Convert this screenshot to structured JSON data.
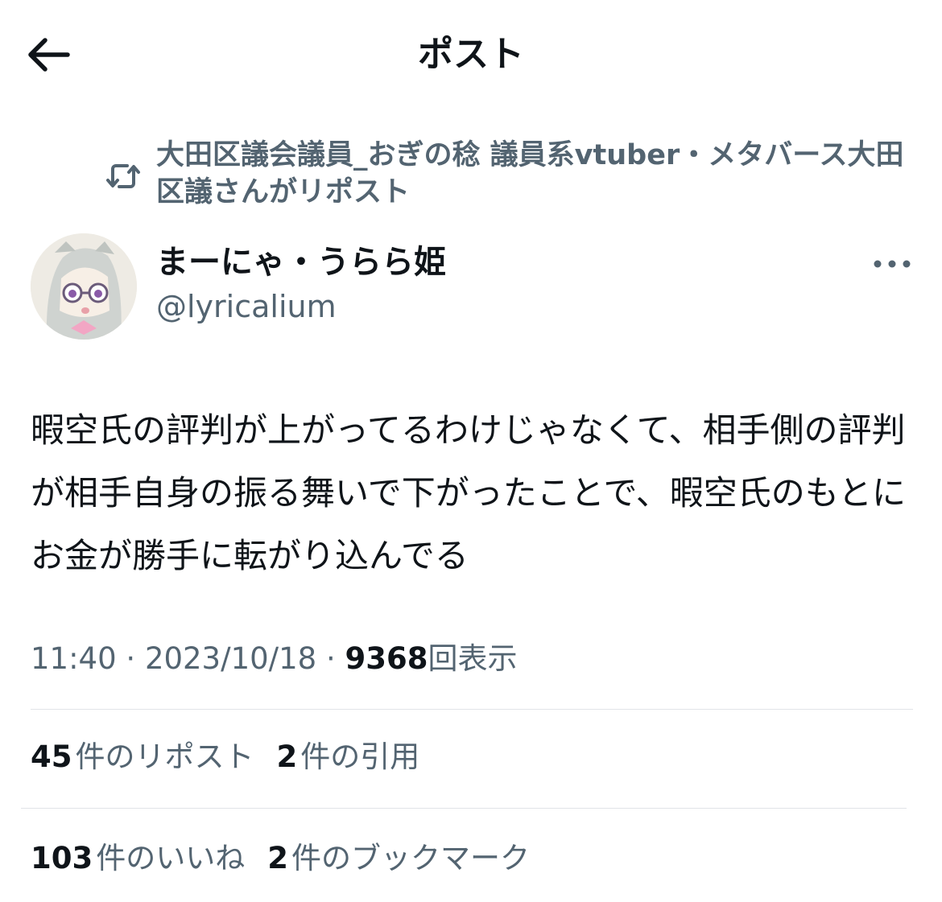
{
  "header": {
    "title": "ポスト",
    "back_icon": "arrow-left-icon"
  },
  "repost": {
    "icon": "repost-icon",
    "text": "大田区議会議員_おぎの稔 議員系vtuber・メタバース大田区議さんがリポスト"
  },
  "author": {
    "name": "まーにゃ・うらら姫",
    "handle": "@lyricalium",
    "more_icon": "more-horizontal-icon"
  },
  "post": {
    "text": "暇空氏の評判が上がってるわけじゃなくて、相手側の評判が相手自身の振る舞いで下がったことで、暇空氏のもとにお金が勝手に転がり込んでる"
  },
  "meta": {
    "time": "11:40",
    "sep1": "·",
    "date": "2023/10/18",
    "sep2": "·",
    "views": "9368",
    "views_label": "回表示"
  },
  "stats": {
    "reposts": "45",
    "reposts_label": "件のリポスト",
    "quotes": "2",
    "quotes_label": "件の引用",
    "likes": "103",
    "likes_label": "件のいいね",
    "bookmarks": "2",
    "bookmarks_label": "件のブックマーク"
  },
  "colors": {
    "text_primary": "#0f1419",
    "text_secondary": "#536471",
    "divider": "#e1e4e8"
  }
}
